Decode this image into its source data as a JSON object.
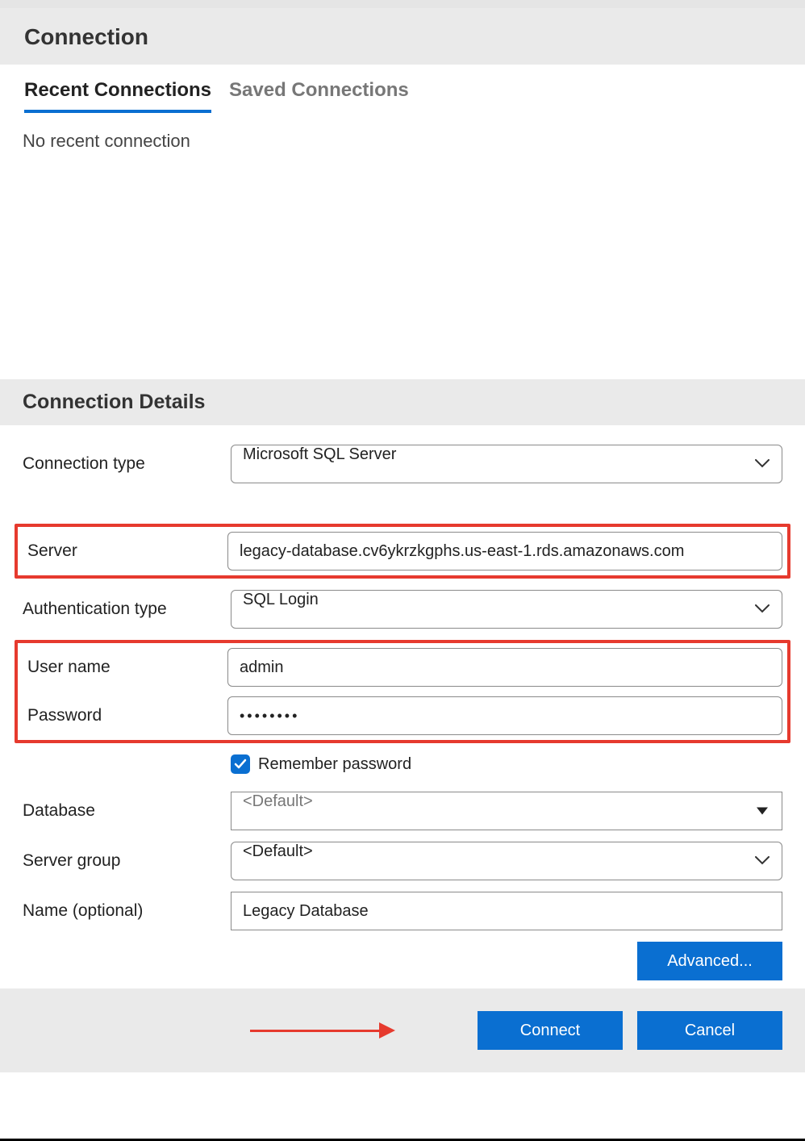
{
  "header": {
    "title": "Connection"
  },
  "tabs": {
    "recent": "Recent Connections",
    "saved": "Saved Connections",
    "empty_message": "No recent connection"
  },
  "details": {
    "title": "Connection Details",
    "labels": {
      "connection_type": "Connection type",
      "server": "Server",
      "auth_type": "Authentication type",
      "username": "User name",
      "password": "Password",
      "remember": "Remember password",
      "database": "Database",
      "server_group": "Server group",
      "name": "Name (optional)"
    },
    "values": {
      "connection_type": "Microsoft SQL Server",
      "server": "legacy-database.cv6ykrzkgphs.us-east-1.rds.amazonaws.com",
      "auth_type": "SQL Login",
      "username": "admin",
      "password_mask": "••••••••",
      "remember_checked": true,
      "database": "<Default>",
      "server_group": "<Default>",
      "name": "Legacy Database"
    },
    "buttons": {
      "advanced": "Advanced...",
      "connect": "Connect",
      "cancel": "Cancel"
    }
  }
}
